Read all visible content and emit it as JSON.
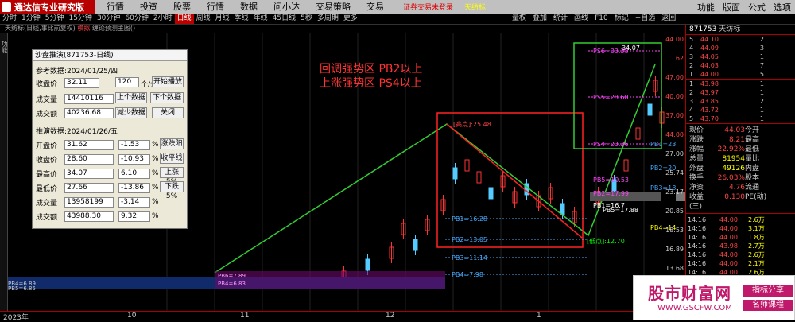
{
  "app": {
    "title": "通达信专业研究版",
    "menu": [
      "行情",
      "投资",
      "股票",
      "行情",
      "数据",
      "问小达",
      "交易策略",
      "交易"
    ],
    "notice": "证券交易未登录",
    "notice2": "天纺标",
    "right_menu": [
      "功能",
      "版面",
      "公式",
      "选项"
    ]
  },
  "tabs": {
    "periods": [
      "分时",
      "1分钟",
      "5分钟",
      "15分钟",
      "30分钟",
      "60分钟",
      "2小时",
      "日线",
      "周线",
      "月线",
      "季线",
      "年线",
      "45日线",
      "5秒",
      "多周期",
      "更多"
    ],
    "active": "日线",
    "right": [
      "量权",
      "叠加",
      "统计",
      "画线",
      "F10",
      "标记",
      "+自选",
      "返回"
    ]
  },
  "info": {
    "text": "天纺标(日线,事比前复权)",
    "mode": "模拟",
    "sub": "缠论预测主图()"
  },
  "dialog": {
    "title": "沙盘推演(871753-日线)",
    "ref_label": "参考数据:2024/01/25/四",
    "close_label": "收盘价",
    "close_val": "32.11",
    "count": "120",
    "unit": "个/分",
    "start": "开始播放",
    "vol_label": "成交量",
    "vol_val": "14410116",
    "prev": "上个数据",
    "next": "下个数据",
    "amt_label": "成交额",
    "amt_val": "40236.68",
    "reduce": "减少数据",
    "close_btn": "关闭",
    "sim_label": "推演数据:2024/01/26/五",
    "rows": [
      {
        "label": "开盘价",
        "val": "31.62",
        "chg": "-1.53",
        "pct": "%",
        "btn": "涨跌阳"
      },
      {
        "label": "收盘价",
        "val": "28.60",
        "chg": "-10.93",
        "pct": "%",
        "btn": "收平线"
      },
      {
        "label": "最高价",
        "val": "34.07",
        "chg": "6.10",
        "pct": "%",
        "btn": "上涨5%"
      },
      {
        "label": "最低价",
        "val": "27.66",
        "chg": "-13.86",
        "pct": "%",
        "btn": "下跌5%"
      },
      {
        "label": "成交量",
        "val": "13958199",
        "chg": "-3.14",
        "pct": "%",
        "btn": ""
      },
      {
        "label": "成交额",
        "val": "43988.30",
        "chg": "9.32",
        "pct": "%",
        "btn": ""
      }
    ]
  },
  "annotation": {
    "line1": "回调强势区 PB2以上",
    "line2": "上涨强势区 PS4以上"
  },
  "chart_labels": {
    "high": "[高点]:25.48",
    "low": "[低点]:12.70",
    "pb1": "PB1=16.28",
    "pb2": "PB2=13.05",
    "pb3": "PB3=11.14",
    "pb4": "PB4=7.98",
    "ps6": "PS6=33.38",
    "ps5": "PS5=28.60",
    "ps4": "PS4=23.36",
    "pb5": "PB5=19.53",
    "pb6": "PB2=17.99",
    "pb7": "PB1=16.7",
    "pb8": "PB5=17.88",
    "pb9": "PB1=23",
    "pb10": "PB2=20",
    "pb11": "PB3=18",
    "pb12": "PB4=14",
    "left1": "PB4=6.89",
    "left2": "PB5=6.85",
    "left3": "PB6=7.89",
    "left4": "PB4=6.83",
    "top": "34.07"
  },
  "xaxis": [
    "2023年",
    "10",
    "11",
    "12",
    "1"
  ],
  "yaxis": [
    "44.00",
    "62",
    "47.00",
    "40.00",
    "37.00",
    "44.00",
    "27.00",
    "25.74",
    "23.17",
    "20.85",
    "18.53",
    "16.89",
    "13.68",
    "11.58"
  ],
  "quote": {
    "code": "871753",
    "name": "天纺标",
    "asks": [
      {
        "n": "5",
        "p": "44.10",
        "v": "2"
      },
      {
        "n": "4",
        "p": "44.09",
        "v": "3"
      },
      {
        "n": "3",
        "p": "44.05",
        "v": "1"
      },
      {
        "n": "2",
        "p": "44.03",
        "v": "7"
      },
      {
        "n": "1",
        "p": "44.00",
        "v": "15"
      }
    ],
    "bids": [
      {
        "n": "1",
        "p": "43.98",
        "v": "1"
      },
      {
        "n": "2",
        "p": "43.97",
        "v": "1"
      },
      {
        "n": "3",
        "p": "43.85",
        "v": "2"
      },
      {
        "n": "4",
        "p": "43.72",
        "v": "1"
      },
      {
        "n": "5",
        "p": "43.70",
        "v": "1"
      }
    ],
    "stats": [
      {
        "k": "现价",
        "v": "44.03",
        "k2": "今开",
        "v2": ""
      },
      {
        "k": "涨跌",
        "v": "8.21",
        "k2": "最高",
        "v2": ""
      },
      {
        "k": "涨幅",
        "v": "22.92%",
        "k2": "最低",
        "v2": ""
      },
      {
        "k": "总量",
        "v": "81954",
        "k2": "量比",
        "v2": ""
      },
      {
        "k": "外盘",
        "v": "49126",
        "k2": "内盘",
        "v2": ""
      },
      {
        "k": "换手",
        "v": "26.03%",
        "k2": "股本",
        "v2": ""
      },
      {
        "k": "净资",
        "v": "4.76",
        "k2": "流通",
        "v2": ""
      },
      {
        "k": "收益(三)",
        "v": "0.130",
        "k2": "PE(动)",
        "v2": ""
      }
    ],
    "ticks": [
      [
        "14:16",
        "44.00",
        "2.6万"
      ],
      [
        "14:16",
        "44.00",
        "3.1万"
      ],
      [
        "14:16",
        "44.00",
        "1.8万"
      ],
      [
        "14:16",
        "43.98",
        "2.7万"
      ],
      [
        "14:16",
        "44.00",
        "2.6万"
      ],
      [
        "14:16",
        "44.00",
        "2.1万"
      ],
      [
        "14:16",
        "44.00",
        "2.6万"
      ]
    ]
  },
  "ad": {
    "big": "股市财富网",
    "url": "WWW.GSCFW.COM",
    "badge1": "指标分享",
    "badge2": "名师课程"
  }
}
